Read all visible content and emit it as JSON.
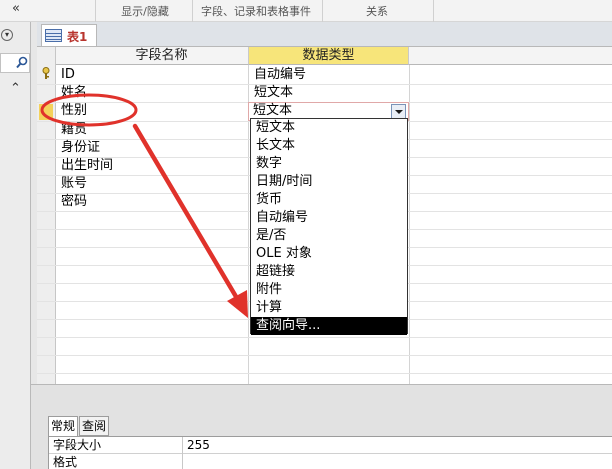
{
  "ribbon": {
    "groups": [
      "显示/隐藏",
      "字段、记录和表格事件",
      "关系"
    ]
  },
  "nav": {
    "icons": [
      "chevron-down-icon",
      "search-icon",
      "double-chevron-up-icon",
      "collapse-left-icon"
    ]
  },
  "doc_tab": {
    "label": "表1",
    "icon": "table-icon"
  },
  "grid": {
    "headers": {
      "field_name": "字段名称",
      "data_type": "数据类型",
      "description": ""
    },
    "rows": [
      {
        "name": "ID",
        "type": "自动编号",
        "primary_key": true
      },
      {
        "name": "姓名",
        "type": "短文本"
      },
      {
        "name": "性别",
        "type": "短文本",
        "active": true
      },
      {
        "name": "籍贯",
        "type": ""
      },
      {
        "name": "身份证",
        "type": ""
      },
      {
        "name": "出生时间",
        "type": ""
      },
      {
        "name": "账号",
        "type": ""
      },
      {
        "name": "密码",
        "type": ""
      }
    ]
  },
  "dropdown": {
    "options": [
      "短文本",
      "长文本",
      "数字",
      "日期/时间",
      "货币",
      "自动编号",
      "是/否",
      "OLE 对象",
      "超链接",
      "附件",
      "计算",
      "查阅向导..."
    ],
    "highlighted": "查阅向导..."
  },
  "properties": {
    "tabs": [
      "常规",
      "查阅"
    ],
    "active_tab": "常规",
    "rows": [
      {
        "label": "字段大小",
        "value": "255"
      },
      {
        "label": "格式",
        "value": ""
      }
    ]
  },
  "annotation": {
    "color": "#e0322b"
  }
}
